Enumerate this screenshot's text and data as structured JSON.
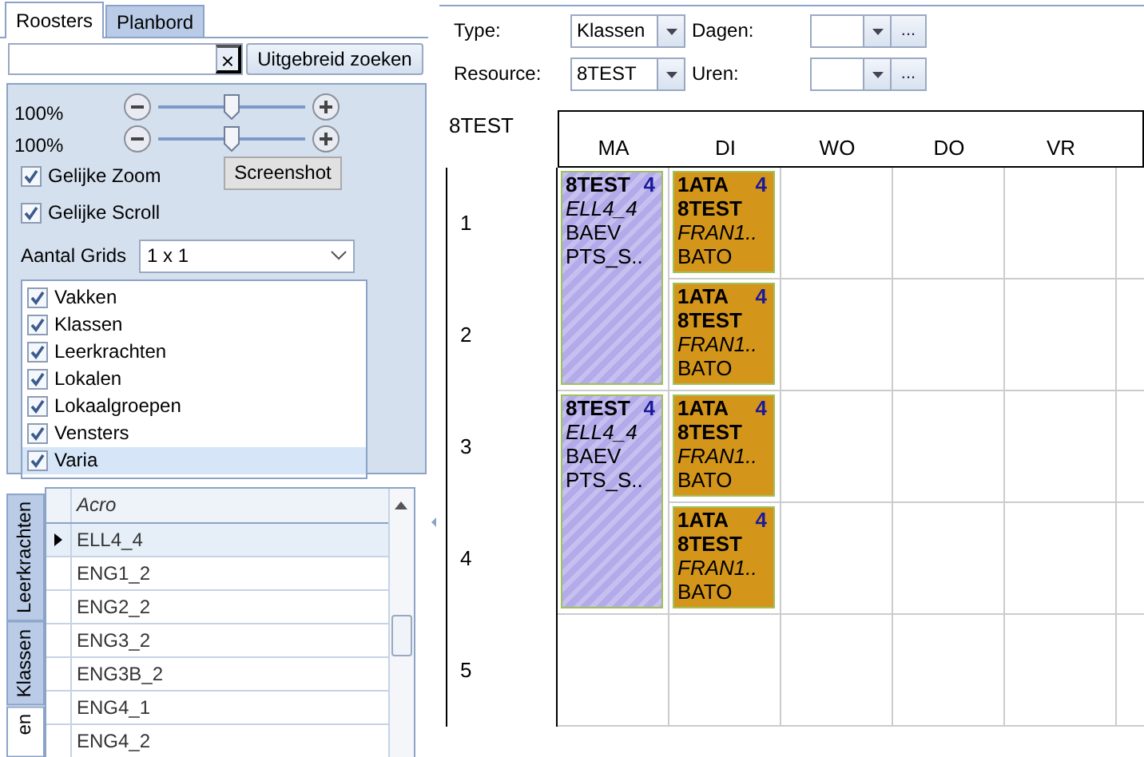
{
  "tabs": [
    {
      "label": "Roosters",
      "selected": true
    },
    {
      "label": "Planbord",
      "selected": false
    }
  ],
  "search": {
    "clear": "×",
    "button": "Uitgebreid zoeken"
  },
  "zoom_sliders": [
    {
      "label": "100%",
      "level": 0.5
    },
    {
      "label": "100%",
      "level": 0.5
    }
  ],
  "options": [
    {
      "label": "Gelijke Zoom",
      "checked": true
    },
    {
      "label": "Gelijke Scroll",
      "checked": true
    }
  ],
  "screenshot_button": "Screenshot",
  "grids": {
    "label": "Aantal Grids",
    "value": "1 x 1"
  },
  "filters": [
    {
      "label": "Vakken",
      "checked": true,
      "selected": false
    },
    {
      "label": "Klassen",
      "checked": true,
      "selected": false
    },
    {
      "label": "Leerkrachten",
      "checked": true,
      "selected": false
    },
    {
      "label": "Lokalen",
      "checked": true,
      "selected": false
    },
    {
      "label": "Lokaalgroepen",
      "checked": true,
      "selected": false
    },
    {
      "label": "Vensters",
      "checked": true,
      "selected": false
    },
    {
      "label": "Varia",
      "checked": true,
      "selected": true
    }
  ],
  "side_tabs": [
    {
      "label": "Leerkrachten",
      "selected": false
    },
    {
      "label": "Klassen",
      "selected": false
    },
    {
      "label": "en",
      "selected": true
    }
  ],
  "list_table": {
    "column": "Acro",
    "rows": [
      {
        "value": "ELL4_4",
        "selected": true
      },
      {
        "value": "ENG1_2",
        "selected": false
      },
      {
        "value": "ENG2_2",
        "selected": false
      },
      {
        "value": "ENG3_2",
        "selected": false
      },
      {
        "value": "ENG3B_2",
        "selected": false
      },
      {
        "value": "ENG4_1",
        "selected": false
      },
      {
        "value": "ENG4_2",
        "selected": false
      }
    ]
  },
  "fields": [
    {
      "label": "Type:",
      "value": "Klassen"
    },
    {
      "label": "Dagen:",
      "more": "..."
    },
    {
      "label": "Resource:",
      "value": "8TEST"
    },
    {
      "label": "Uren:",
      "more": "..."
    }
  ],
  "schedule": {
    "title": "8TEST",
    "days": [
      "MA",
      "DI",
      "WO",
      "DO",
      "VR"
    ],
    "periods": [
      "1",
      "2",
      "3",
      "4",
      "5"
    ],
    "rows": [
      {
        "cells": [
          {
            "kind": "lesson",
            "color": "#b3aaea",
            "hatched": true,
            "title": "8TEST",
            "count": "4",
            "lines": [
              {
                "text": "ELL4_4",
                "kind": "italic"
              },
              {
                "text": "BAEV",
                "kind": "plain"
              },
              {
                "text": "PTS_S..",
                "kind": "plain"
              }
            ]
          },
          {
            "kind": "lesson",
            "color": "#d4961a",
            "hatched": false,
            "title": "1ATA",
            "count": "4",
            "lines": [
              {
                "text": "8TEST",
                "kind": "bold"
              },
              {
                "text": "FRAN1..",
                "kind": "italic"
              },
              {
                "text": "BATO",
                "kind": "plain"
              }
            ]
          },
          {
            "kind": "empty"
          },
          {
            "kind": "empty"
          },
          {
            "kind": "empty"
          },
          {
            "kind": "empty"
          }
        ]
      },
      {
        "cells": [
          {
            "kind": "continued"
          },
          {
            "kind": "lesson",
            "color": "#d4961a",
            "hatched": false,
            "title": "1ATA",
            "count": "4",
            "lines": [
              {
                "text": "8TEST",
                "kind": "bold"
              },
              {
                "text": "FRAN1..",
                "kind": "italic"
              },
              {
                "text": "BATO",
                "kind": "plain"
              }
            ]
          },
          {
            "kind": "empty"
          },
          {
            "kind": "empty"
          },
          {
            "kind": "empty"
          },
          {
            "kind": "empty"
          }
        ]
      },
      {
        "cells": [
          {
            "kind": "lesson",
            "color": "#b3aaea",
            "hatched": true,
            "title": "8TEST",
            "count": "4",
            "lines": [
              {
                "text": "ELL4_4",
                "kind": "italic"
              },
              {
                "text": "BAEV",
                "kind": "plain"
              },
              {
                "text": "PTS_S..",
                "kind": "plain"
              }
            ]
          },
          {
            "kind": "lesson",
            "color": "#d4961a",
            "hatched": false,
            "title": "1ATA",
            "count": "4",
            "lines": [
              {
                "text": "8TEST",
                "kind": "bold"
              },
              {
                "text": "FRAN1..",
                "kind": "italic"
              },
              {
                "text": "BATO",
                "kind": "plain"
              }
            ]
          },
          {
            "kind": "empty"
          },
          {
            "kind": "empty"
          },
          {
            "kind": "empty"
          },
          {
            "kind": "empty"
          }
        ]
      },
      {
        "cells": [
          {
            "kind": "continued"
          },
          {
            "kind": "lesson",
            "color": "#d4961a",
            "hatched": false,
            "title": "1ATA",
            "count": "4",
            "lines": [
              {
                "text": "8TEST",
                "kind": "bold"
              },
              {
                "text": "FRAN1..",
                "kind": "italic"
              },
              {
                "text": "BATO",
                "kind": "plain"
              }
            ]
          },
          {
            "kind": "empty"
          },
          {
            "kind": "empty"
          },
          {
            "kind": "empty"
          },
          {
            "kind": "empty"
          }
        ]
      },
      {
        "cells": [
          {
            "kind": "empty"
          },
          {
            "kind": "empty"
          },
          {
            "kind": "empty"
          },
          {
            "kind": "empty"
          },
          {
            "kind": "empty"
          },
          {
            "kind": "empty"
          }
        ]
      }
    ]
  }
}
